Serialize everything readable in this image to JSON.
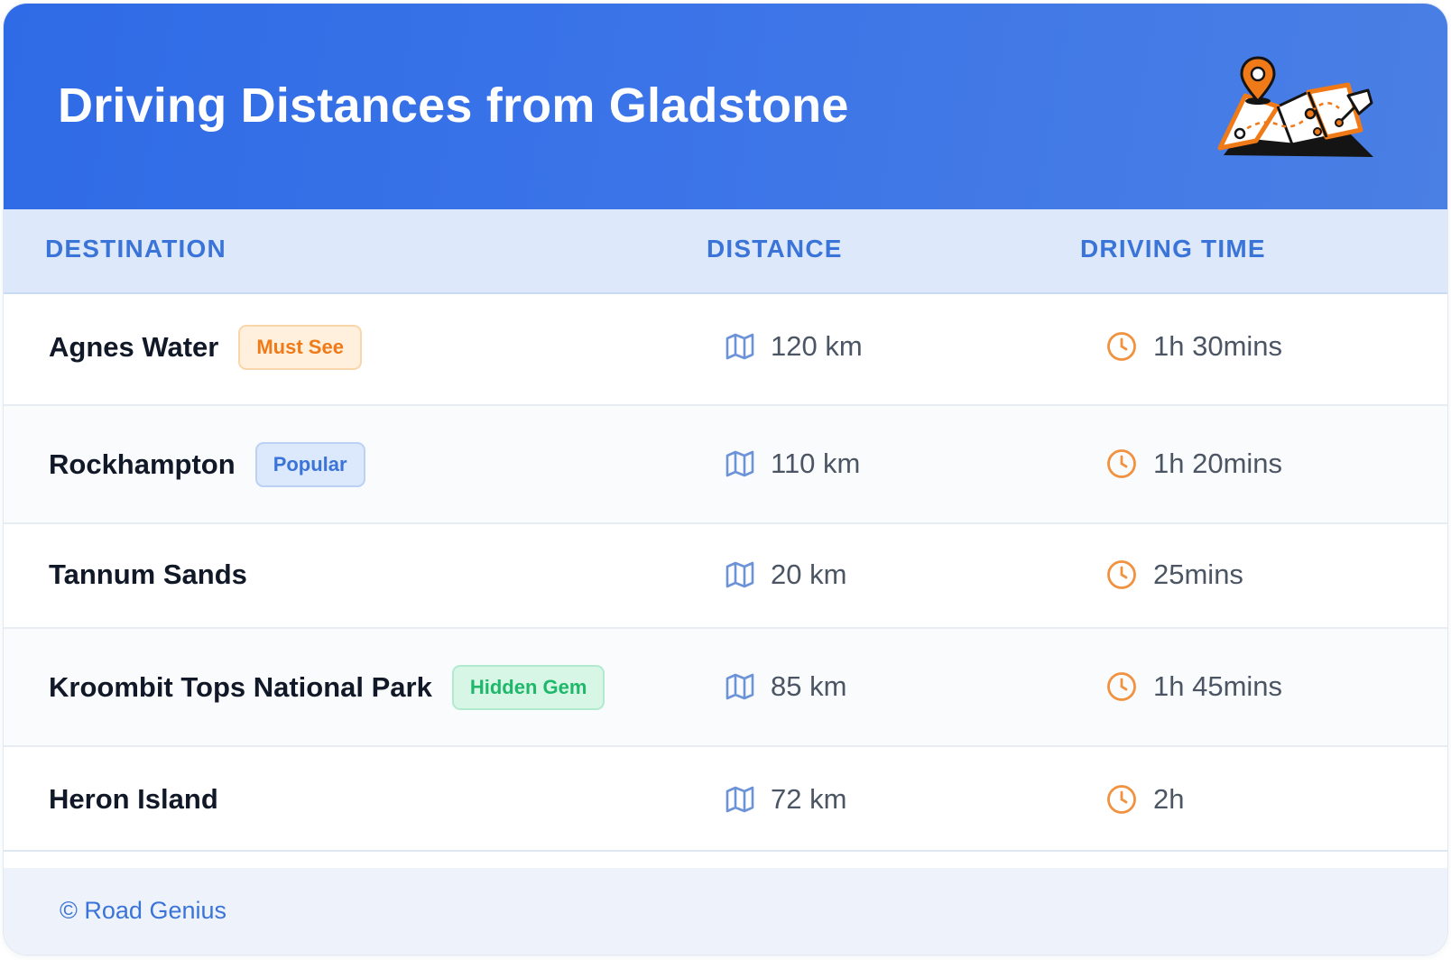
{
  "header": {
    "title": "Driving Distances from Gladstone",
    "illustration": "map-with-pins-icon"
  },
  "columns": {
    "destination": "DESTINATION",
    "distance": "DISTANCE",
    "driving_time": "DRIVING TIME"
  },
  "rows": [
    {
      "destination": "Agnes Water",
      "badge": "Must See",
      "distance": "120 km",
      "time": "1h 30mins"
    },
    {
      "destination": "Rockhampton",
      "badge": "Popular",
      "distance": "110 km",
      "time": "1h 20mins"
    },
    {
      "destination": "Tannum Sands",
      "distance": "20 km",
      "time": "25mins"
    },
    {
      "destination": "Kroombit Tops National Park",
      "badge": "Hidden Gem",
      "distance": "85 km",
      "time": "1h 45mins"
    },
    {
      "destination": "Heron Island",
      "distance": "72 km",
      "time": "2h"
    }
  ],
  "icons": {
    "distance": "map-icon",
    "time": "clock-icon"
  },
  "footer": {
    "text": "© Road Genius"
  },
  "colors": {
    "header_gradient_start": "#2f6be6",
    "header_gradient_end": "#4a7fe4",
    "accent_blue": "#3b74d8",
    "accent_orange": "#f07a18",
    "accent_green": "#1fb86a"
  }
}
